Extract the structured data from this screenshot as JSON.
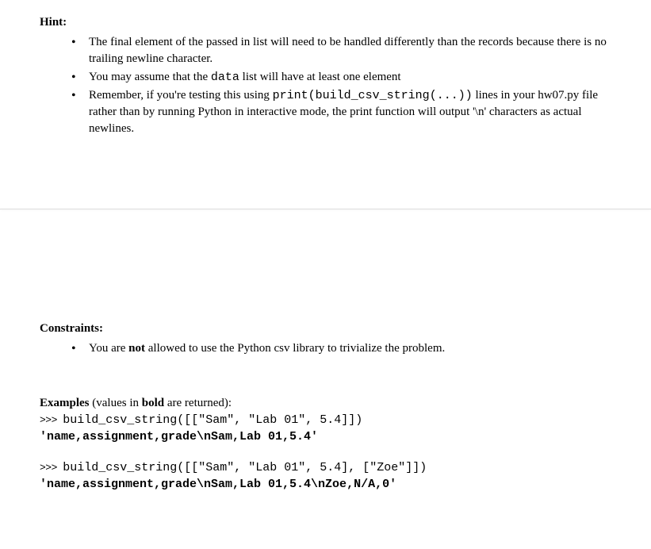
{
  "hint": {
    "heading": "Hint:",
    "items": [
      {
        "pre": "The final element of the passed in list will need to be handled differently than the records because there is no trailing newline character."
      },
      {
        "pre": "You may assume that the ",
        "code1": "data",
        "post": " list will have at least one element"
      },
      {
        "pre": "Remember, if you're testing this using ",
        "code1": "print(build_csv_string(...))",
        "post": " lines in your hw07.py file rather than by running Python in interactive mode, the print function will output '\\n' characters as actual newlines."
      }
    ]
  },
  "constraints": {
    "heading": "Constraints:",
    "item_pre": "You are ",
    "item_bold": "not",
    "item_post": " allowed to use the Python csv library to trivialize the problem."
  },
  "examples": {
    "heading": "Examples",
    "paren": " (values in ",
    "bold_word": "bold",
    "paren_end": " are returned):",
    "prompt_prefix": ">>> ",
    "ex1_call": "build_csv_string([[\"Sam\", \"Lab 01\", 5.4]])",
    "ex1_out": "'name,assignment,grade\\nSam,Lab 01,5.4'",
    "ex2_call": "build_csv_string([[\"Sam\", \"Lab 01\", 5.4], [\"Zoe\"]])",
    "ex2_out": "'name,assignment,grade\\nSam,Lab 01,5.4\\nZoe,N/A,0'"
  }
}
